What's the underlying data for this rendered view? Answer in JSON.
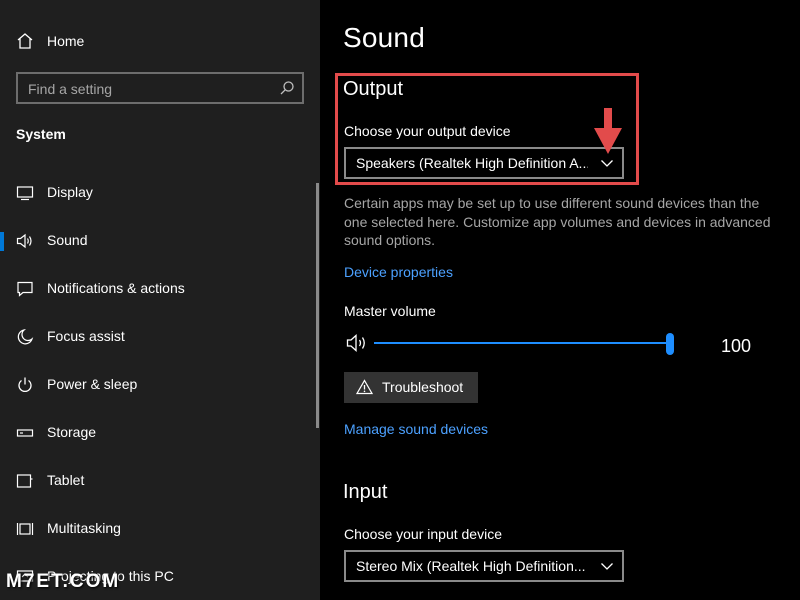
{
  "sidebar": {
    "home_label": "Home",
    "search_placeholder": "Find a setting",
    "section_title": "System",
    "items": [
      {
        "label": "Display",
        "icon": "display-icon"
      },
      {
        "label": "Sound",
        "icon": "speaker-icon",
        "active": true
      },
      {
        "label": "Notifications & actions",
        "icon": "notification-icon"
      },
      {
        "label": "Focus assist",
        "icon": "moon-icon"
      },
      {
        "label": "Power & sleep",
        "icon": "power-icon"
      },
      {
        "label": "Storage",
        "icon": "storage-icon"
      },
      {
        "label": "Tablet",
        "icon": "tablet-icon"
      },
      {
        "label": "Multitasking",
        "icon": "multitasking-icon"
      },
      {
        "label": "Projecting to this PC",
        "icon": "projecting-icon"
      }
    ]
  },
  "main": {
    "title": "Sound",
    "output": {
      "heading": "Output",
      "device_label": "Choose your output device",
      "device_value": "Speakers (Realtek High Definition A...",
      "description": "Certain apps may be set up to use different sound devices than the one selected here. Customize app volumes and devices in advanced sound options.",
      "device_properties_link": "Device properties",
      "master_volume_label": "Master volume",
      "volume_value": "100",
      "volume_level": 1.0,
      "troubleshoot_label": "Troubleshoot",
      "manage_link": "Manage sound devices"
    },
    "input": {
      "heading": "Input",
      "device_label": "Choose your input device",
      "device_value": "Stereo Mix (Realtek High Definition..."
    }
  },
  "watermark": "M7ET.COM",
  "colors": {
    "accent": "#0078d7",
    "link": "#4ca1ff",
    "highlight_box": "#e24b4b",
    "sidebar_bg": "#1f1f1f",
    "main_bg": "#000000"
  }
}
